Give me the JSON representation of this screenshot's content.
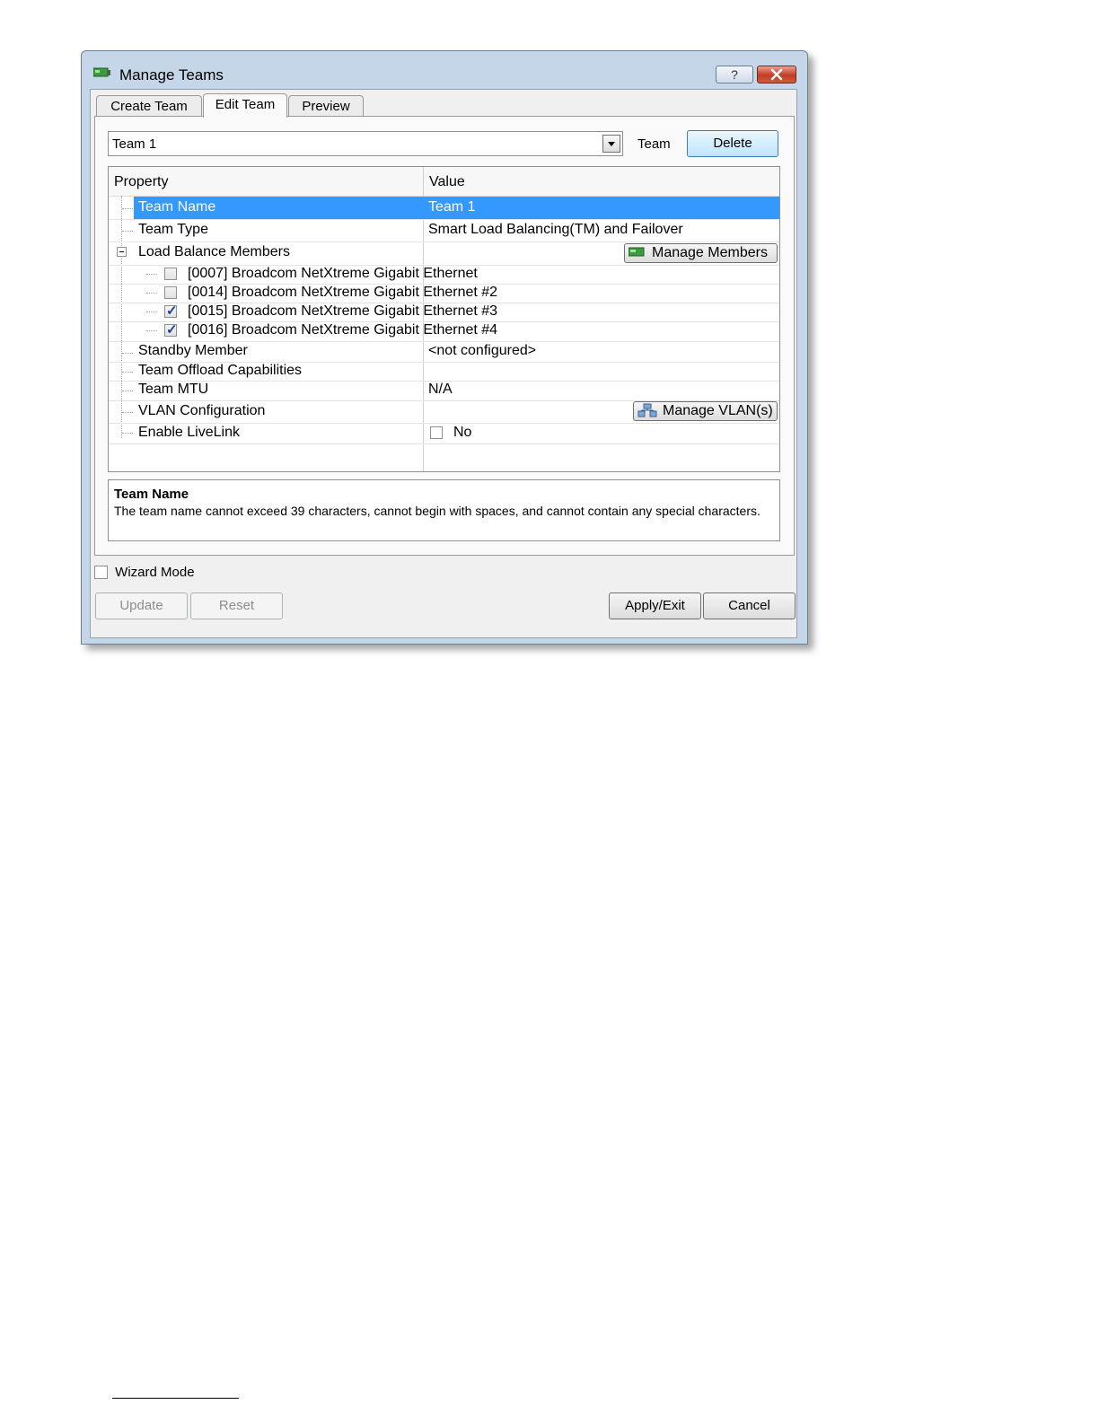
{
  "window": {
    "title": "Manage Teams",
    "help_glyph": "?",
    "close_glyph": "✕"
  },
  "tabs": [
    {
      "label": "Create Team",
      "active": false
    },
    {
      "label": "Edit Team",
      "active": true
    },
    {
      "label": "Preview",
      "active": false
    }
  ],
  "team_selector": {
    "value": "Team 1",
    "label": "Team",
    "delete_label": "Delete"
  },
  "grid": {
    "headers": {
      "property": "Property",
      "value": "Value"
    },
    "rows": {
      "team_name": {
        "property": "Team Name",
        "value": "Team 1"
      },
      "team_type": {
        "property": "Team Type",
        "value": "Smart Load Balancing(TM) and Failover"
      },
      "load_balance": {
        "property": "Load Balance Members",
        "button": "Manage Members"
      },
      "members": [
        {
          "label": "[0007] Broadcom NetXtreme Gigabit Ethernet",
          "checked": false
        },
        {
          "label": "[0014] Broadcom NetXtreme Gigabit Ethernet #2",
          "checked": false
        },
        {
          "label": "[0015] Broadcom NetXtreme Gigabit Ethernet #3",
          "checked": true
        },
        {
          "label": "[0016] Broadcom NetXtreme Gigabit Ethernet #4",
          "checked": true
        }
      ],
      "standby": {
        "property": "Standby Member",
        "value": "<not configured>"
      },
      "offload": {
        "property": "Team Offload Capabilities",
        "value": ""
      },
      "mtu": {
        "property": "Team MTU",
        "value": "N/A"
      },
      "vlan": {
        "property": "VLAN Configuration",
        "button": "Manage VLAN(s)"
      },
      "livelink": {
        "property": "Enable LiveLink",
        "value": "No",
        "checked": false
      }
    }
  },
  "description": {
    "title": "Team Name",
    "text": "The team name cannot exceed 39 characters, cannot begin with spaces, and cannot contain any special characters."
  },
  "wizard_mode": {
    "label": "Wizard Mode",
    "checked": false
  },
  "buttons": {
    "update": "Update",
    "reset": "Reset",
    "apply_exit": "Apply/Exit",
    "cancel": "Cancel"
  },
  "colors": {
    "selection": "#3399ff",
    "window_frame": "#c5d6e8",
    "close": "#c43b22"
  }
}
